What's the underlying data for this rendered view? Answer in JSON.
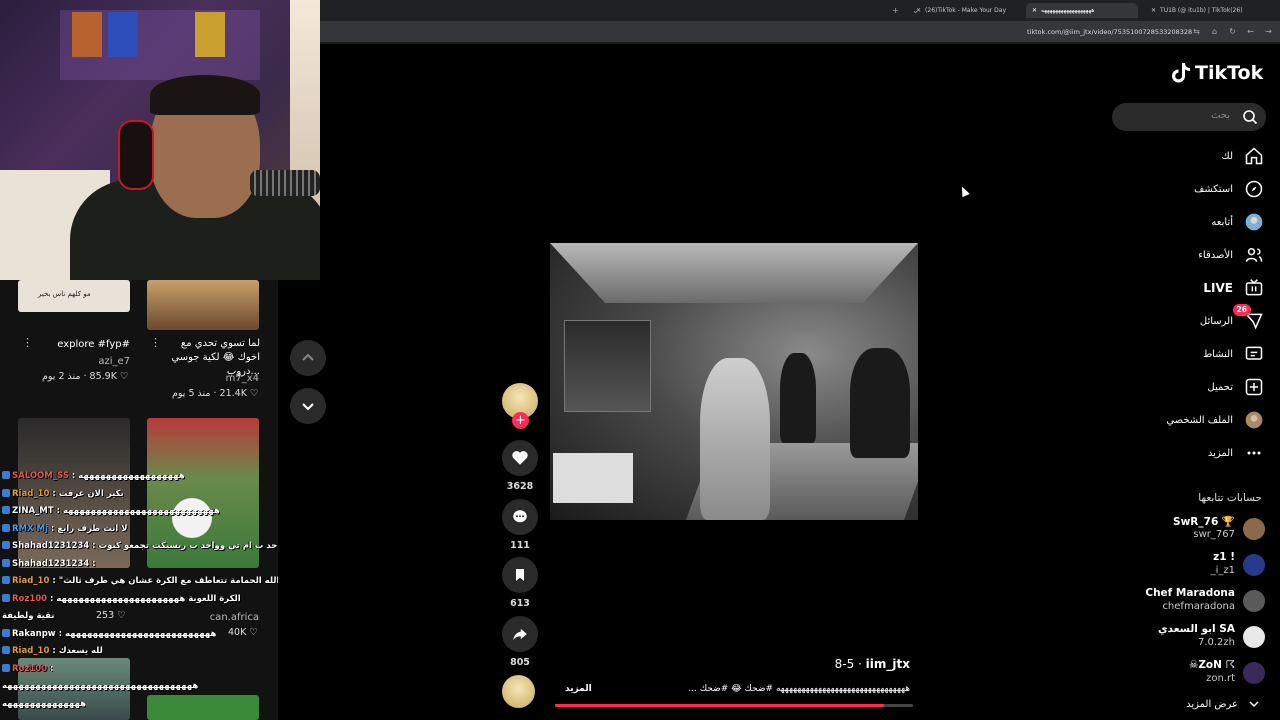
{
  "browser": {
    "tabs": [
      {
        "label": "(26)TikTok - Make Your Day",
        "active": false
      },
      {
        "label": "ههههههههههههههههههه",
        "active": true
      },
      {
        "label": "TU1B (@ itu1b) | TikTok(26)",
        "active": false
      }
    ],
    "url": "tiktok.com/@iim_jtx/video/7535100728533208328"
  },
  "left_grid": {
    "cards": [
      {
        "title": "لما تسوي تحدي مع اخوك 😂 لكية جوسي دروب...",
        "user": "m7_x4",
        "likes": "21.4K",
        "age": "منذ 5 يوم"
      },
      {
        "title": "explore #fyp#",
        "user": "azi_e7",
        "likes": "85.9K",
        "age": "منذ 2 يوم"
      },
      {
        "title": "",
        "user": "can.africa",
        "likes": "40K",
        "age": ""
      },
      {
        "title": "",
        "user": "",
        "likes": "253",
        "age": ""
      }
    ],
    "thumb_caption": "مو كلهم ناس بخير"
  },
  "chat": {
    "lines": [
      {
        "user": "SALOOM_SS",
        "color": "#e05a5a",
        "text": "ههههههههههههههههههه"
      },
      {
        "user": "Riad_10",
        "color": "#e0a030",
        "text": "بكير الان عرفت"
      },
      {
        "user": "ZINA_MT",
        "color": "#ffffff",
        "text": "هههههههههههههههههههههههههههه"
      },
      {
        "user": "RMX Mj",
        "color": "#4a9ee8",
        "text": "لا انت طرف رابع"
      },
      {
        "user": "Shahad1231234",
        "color": "#ffffff",
        "text": "حد ب ام تي وواحد ب ريسيكت تجمعو كبوت"
      },
      {
        "user": "Shahad1231234",
        "color": "#ffffff",
        "text": ""
      },
      {
        "user": "Riad_10",
        "color": "#e0a030",
        "text": "\"والله الحمامة تتعاطف مع الكرة عشان هي طرف ثالث"
      },
      {
        "user": "Roz100",
        "color": "#e05a5a",
        "text": "الكرة اللعوبة ههههههههههههههههههههههه"
      },
      {
        "user": "",
        "color": "#ffffff",
        "text": "نقية ولطيفة"
      },
      {
        "user": "Rakanpw",
        "color": "#ffffff",
        "text": "ههههههههههههههههههههههههههه"
      },
      {
        "user": "Riad_10",
        "color": "#e0a030",
        "text": "لله يسعدك"
      },
      {
        "user": "Roz100",
        "color": "#e05a5a",
        "text": ""
      },
      {
        "user": "",
        "color": "#ffffff",
        "text": "ههههههههههههههههههههههههههههههههههه"
      },
      {
        "user": "",
        "color": "#ffffff",
        "text": "ههههههههههههههه"
      }
    ]
  },
  "video": {
    "author": "iim_jtx",
    "date": "8-5",
    "description": "هههههههههههههههههههههههههههههههه #ضحك 😂 #ضحك ...",
    "more": "المزيد",
    "progress": 0.92,
    "likes": "3628",
    "comments": "111",
    "saves": "613",
    "shares": "805"
  },
  "sidebar": {
    "logo": "TikTok",
    "search_placeholder": "بحث",
    "nav": [
      {
        "label": "لك",
        "icon": "home-icon"
      },
      {
        "label": "استكشف",
        "icon": "compass-icon"
      },
      {
        "label": "أتابعه",
        "icon": "following-avatar-icon"
      },
      {
        "label": "الأصدقاء",
        "icon": "friends-icon"
      },
      {
        "label": "LIVE",
        "icon": "live-icon"
      },
      {
        "label": "الرسائل",
        "icon": "messages-icon",
        "badge": "26"
      },
      {
        "label": "النشاط",
        "icon": "activity-icon"
      },
      {
        "label": "تحميل",
        "icon": "upload-icon"
      },
      {
        "label": "الملف الشخصي",
        "icon": "profile-icon"
      },
      {
        "label": "المزيد",
        "icon": "more-icon"
      }
    ],
    "following_header": "حسابات تتابعها",
    "following": [
      {
        "name": "SwR_76 🏆",
        "user": "swr_767"
      },
      {
        "name": "z1 !",
        "user": "_i_z1"
      },
      {
        "name": "Chef Maradona",
        "user": "chefmaradona"
      },
      {
        "name": "ابو السعدي SA",
        "user": "7.0.2zh"
      },
      {
        "name": "☠ZoN ☈",
        "user": "zon.rt"
      }
    ],
    "see_more": "عرض المزيد"
  },
  "colors": {
    "accent": "#fe2c55",
    "background": "#000000",
    "sidebar_text": "#ffffff"
  }
}
